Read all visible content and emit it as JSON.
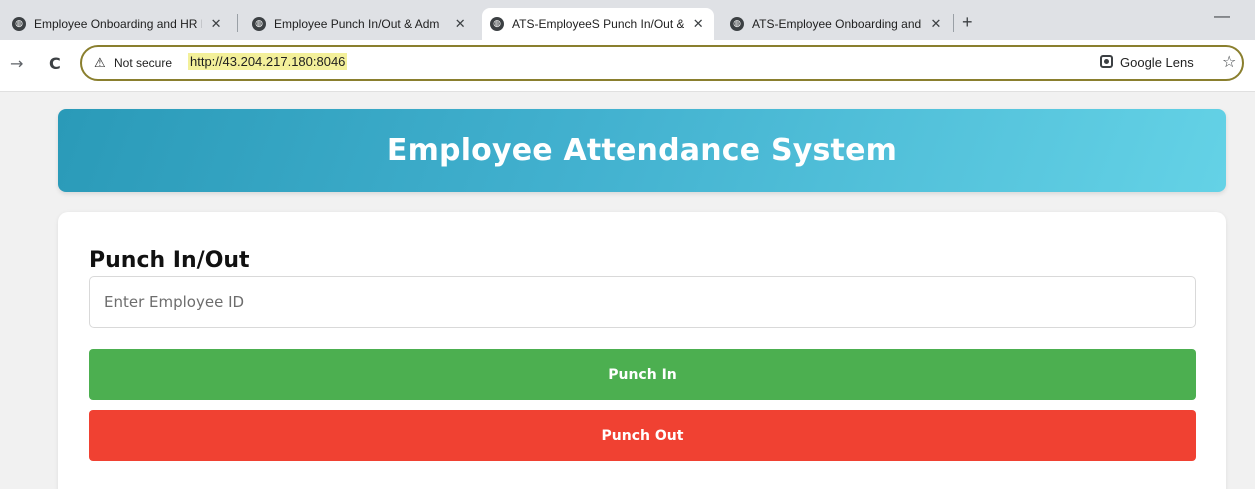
{
  "browser": {
    "tabs": [
      {
        "title": "Employee Onboarding and HR I",
        "active": false
      },
      {
        "title": "Employee Punch In/Out & Adm",
        "active": false
      },
      {
        "title": "ATS-EmployeeS Punch In/Out &",
        "active": true
      },
      {
        "title": "ATS-Employee Onboarding and",
        "active": false
      }
    ],
    "new_tab_glyph": "+",
    "minimize_glyph": "—",
    "security_label": "Not secure",
    "url": "http://43.204.217.180:8046",
    "lens_label": "Google Lens"
  },
  "page": {
    "header_title": "Employee Attendance System",
    "card_title": "Punch In/Out",
    "employee_input": {
      "placeholder": "Enter Employee ID",
      "value": ""
    },
    "punch_in_label": "Punch In",
    "punch_out_label": "Punch Out"
  },
  "colors": {
    "header_gradient_start": "#2a9ab8",
    "header_gradient_end": "#64d2e6",
    "punch_in": "#4caf50",
    "punch_out": "#f04132"
  }
}
